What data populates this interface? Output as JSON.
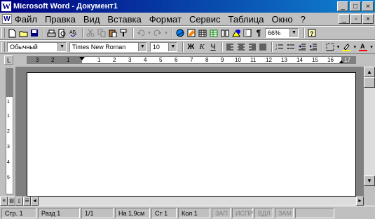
{
  "window": {
    "app_icon": "W",
    "title": "Microsoft Word - Документ1",
    "minimize": "_",
    "maximize": "□",
    "close": "×"
  },
  "menu": {
    "doc_icon": "W",
    "items": [
      "Файл",
      "Правка",
      "Вид",
      "Вставка",
      "Формат",
      "Сервис",
      "Таблица",
      "Окно",
      "?"
    ],
    "mdi_minimize": "_",
    "mdi_restore": "▫",
    "mdi_close": "×"
  },
  "standard_toolbar": {
    "icons": [
      "new-icon",
      "open-icon",
      "save-icon",
      "print-icon",
      "print-preview-icon",
      "spelling-icon",
      "cut-icon",
      "copy-icon",
      "paste-icon",
      "format-painter-icon",
      "undo-icon",
      "redo-icon",
      "hyperlink-icon",
      "tables-borders-icon",
      "insert-table-icon",
      "insert-excel-icon",
      "columns-icon",
      "drawing-icon",
      "document-map-icon",
      "show-hide-icon",
      "help-icon"
    ],
    "zoom": "66%"
  },
  "format_toolbar": {
    "style": "Обычный",
    "font": "Times New Roman",
    "size": "10",
    "bold": "Ж",
    "italic": "К",
    "underline": "Ч"
  },
  "ruler": {
    "tab_selector": "L",
    "numbers": [
      "3",
      "2",
      "1",
      "1",
      "2",
      "3",
      "4",
      "5",
      "6",
      "7",
      "8",
      "9",
      "10",
      "11",
      "12",
      "13",
      "14",
      "15",
      "16",
      "17"
    ],
    "vertical_numbers": [
      "1",
      "1",
      "2",
      "3",
      "4",
      "5"
    ]
  },
  "status": {
    "page": "Стр. 1",
    "section": "Разд 1",
    "pages": "1/1",
    "at": "На 1,9см",
    "line": "Ст 1",
    "col": "Кол 1",
    "rec": "ЗАП",
    "trk": "ИСПР",
    "ext": "ВДЛ",
    "ovr": "ЗАМ",
    "lang": ""
  },
  "colors": {
    "title_active": "#000080",
    "face": "#c0c0c0",
    "page": "#ffffff"
  }
}
